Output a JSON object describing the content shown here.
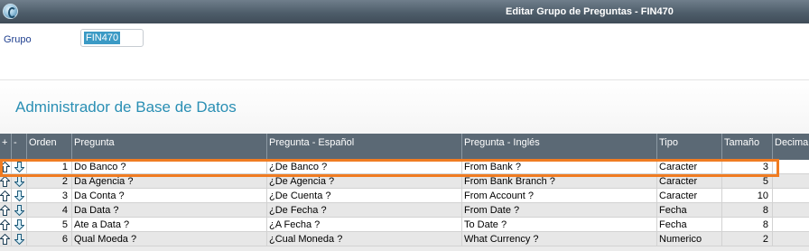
{
  "window": {
    "title": "Editar Grupo de Preguntas - FIN470"
  },
  "form": {
    "grupo_label": "Grupo",
    "grupo_value": "FIN470"
  },
  "section": {
    "title": "Administrador de Base de Datos"
  },
  "grid": {
    "headers": {
      "add": "+",
      "remove": "-",
      "orden": "Orden",
      "pregunta": "Pregunta",
      "pregunta_es": "Pregunta - Español",
      "pregunta_en": "Pregunta - Inglés",
      "tipo": "Tipo",
      "tamano": "Tamaño",
      "decimal": "Decimal"
    },
    "rows": [
      {
        "orden": "1",
        "pregunta": "Do Banco ?",
        "pregunta_es": "¿De Banco ?",
        "pregunta_en": "From Bank ?",
        "tipo": "Caracter",
        "tamano": "3"
      },
      {
        "orden": "2",
        "pregunta": "Da Agencia ?",
        "pregunta_es": "¿De Agencia ?",
        "pregunta_en": "From Bank Branch ?",
        "tipo": "Caracter",
        "tamano": "5"
      },
      {
        "orden": "3",
        "pregunta": "Da Conta ?",
        "pregunta_es": "¿De Cuenta ?",
        "pregunta_en": "From Account ?",
        "tipo": "Caracter",
        "tamano": "10"
      },
      {
        "orden": "4",
        "pregunta": "Da Data ?",
        "pregunta_es": "¿De Fecha ?",
        "pregunta_en": "From Date ?",
        "tipo": "Fecha",
        "tamano": "8"
      },
      {
        "orden": "5",
        "pregunta": "Ate a Data ?",
        "pregunta_es": "¿A Fecha ?",
        "pregunta_en": "To Date ?",
        "tipo": "Fecha",
        "tamano": "8"
      },
      {
        "orden": "6",
        "pregunta": "Qual Moeda ?",
        "pregunta_es": "¿Cual Moneda ?",
        "pregunta_en": "What Currency ?",
        "tipo": "Numerico",
        "tamano": "2"
      }
    ]
  },
  "icons": {
    "app": "app-logo-icon",
    "up": "arrow-up-icon",
    "down": "arrow-down-icon"
  },
  "colors": {
    "highlight": "#f07c22",
    "section_title": "#2a8fb4",
    "header_bg": "#5b6975",
    "selected_text_bg": "#3b9ac5"
  }
}
